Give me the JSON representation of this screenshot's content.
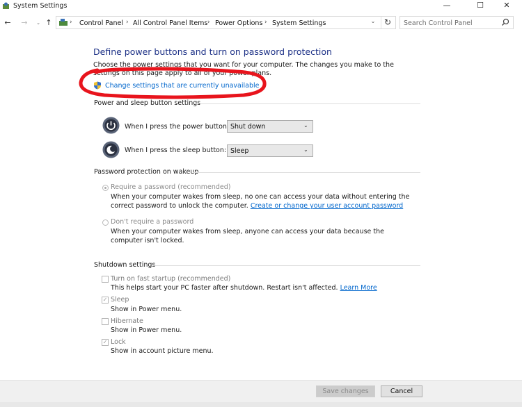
{
  "window": {
    "title": "System Settings",
    "minimize": "—",
    "maximize": "☐",
    "close": "✕"
  },
  "nav": {
    "breadcrumbs": [
      "Control Panel",
      "All Control Panel Items",
      "Power Options",
      "System Settings"
    ],
    "separator": "›",
    "search_placeholder": "Search Control Panel"
  },
  "page": {
    "heading": "Define power buttons and turn on password protection",
    "description": "Choose the power settings that you want for your computer. The changes you make to the settings on this page apply to all of your power plans.",
    "change_link": "Change settings that are currently unavailable"
  },
  "power_section": {
    "title": "Power and sleep button settings",
    "power_button": {
      "label": "When I press the power button:",
      "value": "Shut down"
    },
    "sleep_button": {
      "label": "When I press the sleep button:",
      "value": "Sleep"
    }
  },
  "password_section": {
    "title": "Password protection on wakeup",
    "require": {
      "label": "Require a password (recommended)",
      "desc": "When your computer wakes from sleep, no one can access your data without entering the correct password to unlock the computer.",
      "link": "Create or change your user account password",
      "selected": true
    },
    "no_require": {
      "label": "Don't require a password",
      "desc": "When your computer wakes from sleep, anyone can access your data because the computer isn't locked.",
      "selected": false
    }
  },
  "shutdown_section": {
    "title": "Shutdown settings",
    "items": [
      {
        "label": "Turn on fast startup (recommended)",
        "desc": "This helps start your PC faster after shutdown. Restart isn't affected.",
        "link": "Learn More",
        "checked": false
      },
      {
        "label": "Sleep",
        "desc": "Show in Power menu.",
        "checked": true
      },
      {
        "label": "Hibernate",
        "desc": "Show in Power menu.",
        "checked": false
      },
      {
        "label": "Lock",
        "desc": "Show in account picture menu.",
        "checked": true
      }
    ]
  },
  "footer": {
    "save_label": "Save changes",
    "cancel_label": "Cancel"
  },
  "colors": {
    "heading": "#1e3287",
    "link": "#0066cc",
    "annotation": "#e8141c"
  }
}
